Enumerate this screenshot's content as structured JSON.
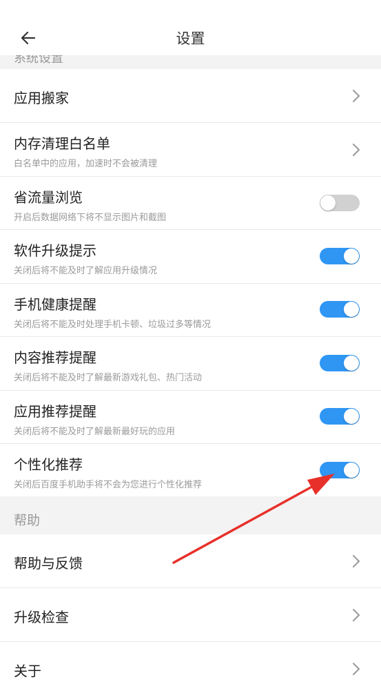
{
  "header": {
    "title": "设置",
    "back_icon": "arrow-left-icon"
  },
  "cut_section_label": "系统设置",
  "settings": {
    "move_app": {
      "label": "应用搬家"
    },
    "memory_whitelist": {
      "label": "内存清理白名单",
      "desc": "白名单中的应用，加速时不会被清理"
    },
    "data_saver": {
      "label": "省流量浏览",
      "desc": "开启后数据网络下将不显示图片和截图",
      "enabled": false
    },
    "update_prompt": {
      "label": "软件升级提示",
      "desc": "关闭后将不能及时了解应用升级情况",
      "enabled": true
    },
    "health_reminder": {
      "label": "手机健康提醒",
      "desc": "关闭后将不能及时处理手机卡顿、垃圾过多等情况",
      "enabled": true
    },
    "content_recommend": {
      "label": "内容推荐提醒",
      "desc": "关闭后将不能及时了解最新游戏礼包、热门活动",
      "enabled": true
    },
    "app_recommend": {
      "label": "应用推荐提醒",
      "desc": "关闭后将不能及时了解最新最好玩的应用",
      "enabled": true
    },
    "personalized": {
      "label": "个性化推荐",
      "desc": "关闭后百度手机助手将不会为您进行个性化推荐",
      "enabled": true
    }
  },
  "help_section": {
    "title": "帮助",
    "feedback": "帮助与反馈",
    "upgrade_check": "升级检查",
    "about": "关于"
  },
  "colors": {
    "toggle_on": "#2f96f3",
    "toggle_off": "#d1d1d1",
    "annotation_arrow": "#e8302a"
  }
}
